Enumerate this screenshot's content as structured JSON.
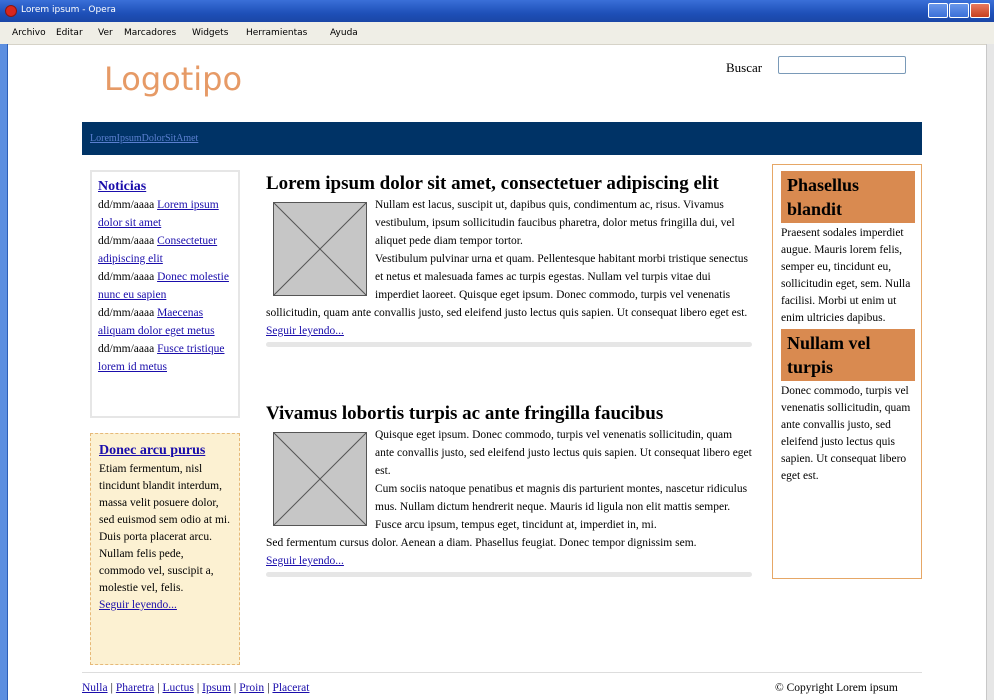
{
  "window": {
    "title": "Lorem ipsum - Opera"
  },
  "menu": [
    "Archivo",
    "Editar",
    "Ver",
    "Marcadores",
    "Widgets",
    "Herramientas",
    "Ayuda"
  ],
  "header": {
    "logo": "Logotipo",
    "search_label": "Buscar",
    "search_value": ""
  },
  "nav": {
    "links": "LoremIpsumDolorSitAmet"
  },
  "news": {
    "title": "Noticias",
    "items": [
      {
        "date": "dd/mm/aaaa",
        "link": "Lorem ipsum dolor sit amet"
      },
      {
        "date": "dd/mm/aaaa",
        "link": "Consectetuer adipiscing elit"
      },
      {
        "date": "dd/mm/aaaa",
        "link": "Donec molestie nunc eu sapien"
      },
      {
        "date": "dd/mm/aaaa",
        "link": "Maecenas aliquam dolor eget metus"
      },
      {
        "date": "dd/mm/aaaa",
        "link": "Fusce tristique lorem id metus"
      }
    ]
  },
  "promo": {
    "title": "Donec arcu purus",
    "p1": "Etiam fermentum, nisl tincidunt blandit interdum, massa velit posuere dolor, sed euismod sem odio at mi.",
    "p2": "Duis porta placerat arcu. Nullam felis pede, commodo vel, suscipit a, molestie vel, felis.",
    "more": "Seguir leyendo..."
  },
  "articles": [
    {
      "title": "Lorem ipsum dolor sit amet, consectetuer adipiscing elit",
      "p1": "Nullam est lacus, suscipit ut, dapibus quis, condimentum ac, risus. Vivamus vestibulum, ipsum sollicitudin faucibus pharetra, dolor metus fringilla dui, vel aliquet pede diam tempor tortor.",
      "p2": "Vestibulum pulvinar urna et quam. Pellentesque habitant morbi tristique senectus et netus et malesuada fames ac turpis egestas. Nullam vel turpis vitae dui imperdiet laoreet. Quisque eget ipsum. Donec commodo, turpis vel venenatis sollicitudin, quam ante convallis justo, sed eleifend justo lectus quis sapien. Ut consequat libero eget est.",
      "more": "Seguir leyendo..."
    },
    {
      "title": "Vivamus lobortis turpis ac ante fringilla faucibus",
      "p1": "Quisque eget ipsum. Donec commodo, turpis vel venenatis sollicitudin, quam ante convallis justo, sed eleifend justo lectus quis sapien. Ut consequat libero eget est.",
      "p2": "Cum sociis natoque penatibus et magnis dis parturient montes, nascetur ridiculus mus. Nullam dictum hendrerit neque. Mauris id ligula non elit mattis semper. Fusce arcu ipsum, tempus eget, tincidunt at, imperdiet in, mi.",
      "p3": "Sed fermentum cursus dolor. Aenean a diam. Phasellus feugiat. Donec tempor dignissim sem.",
      "more": "Seguir leyendo..."
    }
  ],
  "sidebar": [
    {
      "title": "Phasellus blandit",
      "text": "Praesent sodales imperdiet augue. Mauris lorem felis, semper eu, tincidunt eu, sollicitudin eget, sem. Nulla facilisi. Morbi ut enim ut enim ultricies dapibus."
    },
    {
      "title": "Nullam vel turpis",
      "text": "Donec commodo, turpis vel venenatis sollicitudin, quam ante convallis justo, sed eleifend justo lectus quis sapien. Ut consequat libero eget est."
    }
  ],
  "footer": {
    "links": [
      "Nulla",
      "Pharetra",
      "Luctus",
      "Ipsum",
      "Proin",
      "Placerat"
    ],
    "separator": "|",
    "copyright": "© Copyright Lorem ipsum"
  }
}
